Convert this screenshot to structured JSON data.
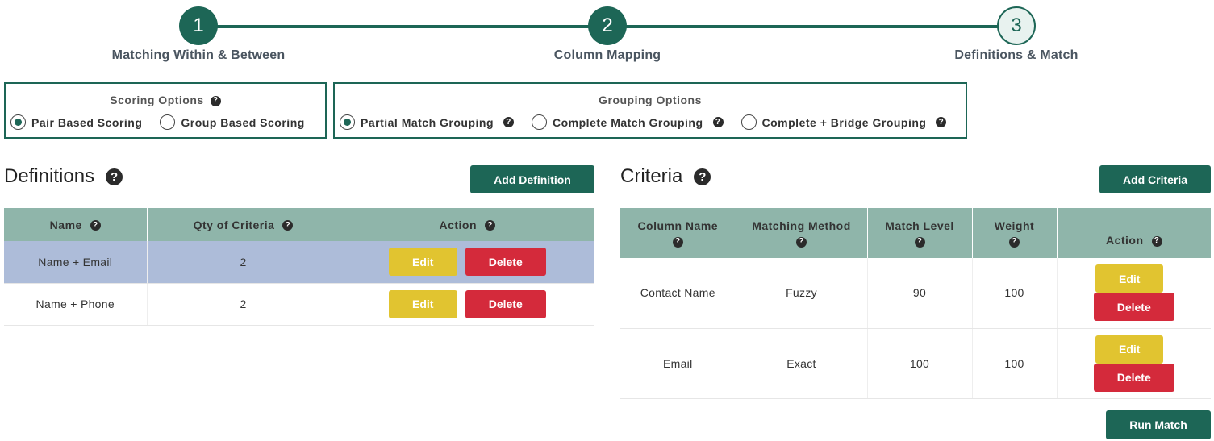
{
  "stepper": {
    "steps": [
      {
        "number": "1",
        "label": "Matching Within & Between",
        "state": "complete"
      },
      {
        "number": "2",
        "label": "Column Mapping",
        "state": "complete"
      },
      {
        "number": "3",
        "label": "Definitions & Match",
        "state": "active"
      }
    ]
  },
  "scoring_options": {
    "title": "Scoring Options",
    "options": [
      {
        "label": "Pair Based Scoring",
        "selected": true
      },
      {
        "label": "Group Based Scoring",
        "selected": false
      }
    ]
  },
  "grouping_options": {
    "title": "Grouping Options",
    "options": [
      {
        "label": "Partial Match Grouping",
        "selected": true
      },
      {
        "label": "Complete Match Grouping",
        "selected": false
      },
      {
        "label": "Complete + Bridge Grouping",
        "selected": false
      }
    ]
  },
  "help_glyph": "?",
  "definitions": {
    "title": "Definitions",
    "add_label": "Add Definition",
    "columns": [
      "Name",
      "Qty of Criteria",
      "Action"
    ],
    "rows": [
      {
        "name": "Name + Email",
        "qty": "2",
        "selected": true
      },
      {
        "name": "Name + Phone",
        "qty": "2",
        "selected": false
      }
    ],
    "edit_label": "Edit",
    "delete_label": "Delete"
  },
  "criteria": {
    "title": "Criteria",
    "add_label": "Add Criteria",
    "columns": [
      "Column Name",
      "Matching Method",
      "Match Level",
      "Weight",
      "Action"
    ],
    "rows": [
      {
        "column_name": "Contact Name",
        "method": "Fuzzy",
        "level": "90",
        "weight": "100"
      },
      {
        "column_name": "Email",
        "method": "Exact",
        "level": "100",
        "weight": "100"
      }
    ],
    "edit_label": "Edit",
    "delete_label": "Delete"
  },
  "run_match_label": "Run Match",
  "colors": {
    "primary": "#1d6656",
    "header": "#8fb5aa",
    "selected_row": "#adbcd9",
    "edit": "#e1c430",
    "delete": "#d42a3b"
  }
}
